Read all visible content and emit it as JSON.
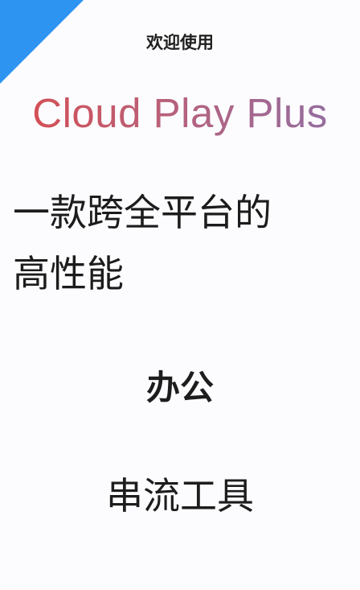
{
  "welcome": "欢迎使用",
  "brand": {
    "name": "Cloud Play Plus",
    "gradient_start": "#d94c4c",
    "gradient_end": "#8e70a6"
  },
  "headline": {
    "line1": "一款跨全平台的",
    "line2": "高性能"
  },
  "features": {
    "primary": "办公",
    "secondary": "串流工具"
  },
  "colors": {
    "corner_banner": "#2d94f2",
    "background": "#fcfcfe",
    "text": "#1f1f1f"
  }
}
